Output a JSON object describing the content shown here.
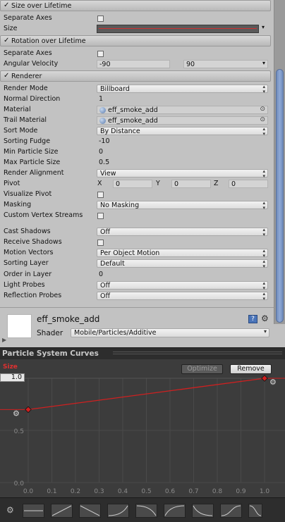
{
  "modules": {
    "size_over_lifetime": {
      "title": "Size over Lifetime",
      "check": "✓"
    },
    "rotation_over_lifetime": {
      "title": "Rotation over Lifetime",
      "check": "✓"
    },
    "renderer": {
      "title": "Renderer",
      "check": "✓"
    }
  },
  "size_over_lifetime": {
    "separate_axes_label": "Separate Axes",
    "size_label": "Size"
  },
  "rotation_over_lifetime": {
    "separate_axes_label": "Separate Axes",
    "angular_velocity_label": "Angular Velocity",
    "angular_velocity_min": "-90",
    "angular_velocity_max": "90"
  },
  "renderer": {
    "render_mode_label": "Render Mode",
    "render_mode": "Billboard",
    "normal_direction_label": "Normal Direction",
    "normal_direction": "1",
    "material_label": "Material",
    "material": "eff_smoke_add",
    "trail_material_label": "Trail Material",
    "trail_material": "eff_smoke_add",
    "sort_mode_label": "Sort Mode",
    "sort_mode": "By Distance",
    "sorting_fudge_label": "Sorting Fudge",
    "sorting_fudge": "-10",
    "min_particle_size_label": "Min Particle Size",
    "min_particle_size": "0",
    "max_particle_size_label": "Max Particle Size",
    "max_particle_size": "0.5",
    "render_alignment_label": "Render Alignment",
    "render_alignment": "View",
    "pivot_label": "Pivot",
    "pivot_x_label": "X",
    "pivot_x": "0",
    "pivot_y_label": "Y",
    "pivot_y": "0",
    "pivot_z_label": "Z",
    "pivot_z": "0",
    "visualize_pivot_label": "Visualize Pivot",
    "masking_label": "Masking",
    "masking": "No Masking",
    "custom_vertex_streams_label": "Custom Vertex Streams",
    "cast_shadows_label": "Cast Shadows",
    "cast_shadows": "Off",
    "receive_shadows_label": "Receive Shadows",
    "motion_vectors_label": "Motion Vectors",
    "motion_vectors": "Per Object Motion",
    "sorting_layer_label": "Sorting Layer",
    "sorting_layer": "Default",
    "order_in_layer_label": "Order in Layer",
    "order_in_layer": "0",
    "light_probes_label": "Light Probes",
    "light_probes": "Off",
    "reflection_probes_label": "Reflection Probes",
    "reflection_probes": "Off"
  },
  "material_panel": {
    "name": "eff_smoke_add",
    "shader_label": "Shader",
    "shader": "Mobile/Particles/Additive",
    "help_icon": "?"
  },
  "curves": {
    "title": "Particle System Curves",
    "curve_label": "Size",
    "optimize_label": "Optimize",
    "remove_label": "Remove",
    "max_value": "1.0",
    "accent": "#d02020"
  },
  "chart_data": {
    "type": "line",
    "xlabel": "",
    "ylabel": "",
    "x_ticks": [
      "0.0",
      "0.1",
      "0.2",
      "0.3",
      "0.4",
      "0.5",
      "0.6",
      "0.7",
      "0.8",
      "0.9",
      "1.0"
    ],
    "y_ticks": [
      "0.5",
      "0.0"
    ],
    "xlim": [
      0,
      1
    ],
    "ylim": [
      0,
      1
    ],
    "series": [
      {
        "x": [
          0.0,
          1.0
        ],
        "y": [
          0.7,
          1.0
        ]
      }
    ]
  }
}
